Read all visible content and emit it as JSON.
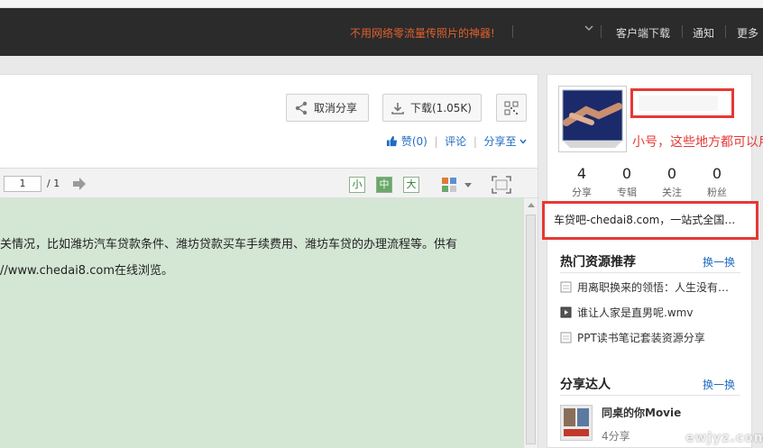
{
  "topbar": {
    "promo": "不用网络零流量传照片的神器!",
    "client_download": "客户端下载",
    "notifications": "通知",
    "more": "更多"
  },
  "toolbar": {
    "cancel_share": "取消分享",
    "download": "下载(1.05K)"
  },
  "actions": {
    "like": "赞(0)",
    "comment": "评论",
    "share_to": "分享至"
  },
  "viewer": {
    "page_current": "1",
    "page_total": "/ 1",
    "size_small": "小",
    "size_medium": "中",
    "size_large": "大"
  },
  "document": {
    "lines": [
      "关情况，比如潍坊汽车贷款条件、潍坊贷款买车手续费用、潍坊车贷的办理流程等。供有",
      "//www.chedai8.com在线浏览。"
    ]
  },
  "profile": {
    "annotation": "小号，这些地方都可以用。",
    "stats": [
      {
        "value": "4",
        "label": "分享"
      },
      {
        "value": "0",
        "label": "专辑"
      },
      {
        "value": "0",
        "label": "关注"
      },
      {
        "value": "0",
        "label": "粉丝"
      }
    ],
    "intro": "车贷吧-chedai8.com，一站式全国…"
  },
  "hot_resources": {
    "title": "热门资源推荐",
    "more": "换一换",
    "items": [
      {
        "icon": "document-icon",
        "text": "用离职换来的领悟：人生没有…"
      },
      {
        "icon": "video-icon",
        "text": "谁让人家是直男呢.wmv"
      },
      {
        "icon": "document-icon",
        "text": "PPT读书笔记套装资源分享"
      }
    ]
  },
  "experts": {
    "title": "分享达人",
    "more": "换一换",
    "name": "同桌的你Movie",
    "count": "4分享"
  },
  "watermark": "ewjyz.com",
  "colors": {
    "topbar_bg": "#2b2b2b",
    "promo": "#e0602e",
    "link": "#1f6bc1",
    "doc_bg": "#d4e6d4",
    "highlight": "#e53935"
  }
}
